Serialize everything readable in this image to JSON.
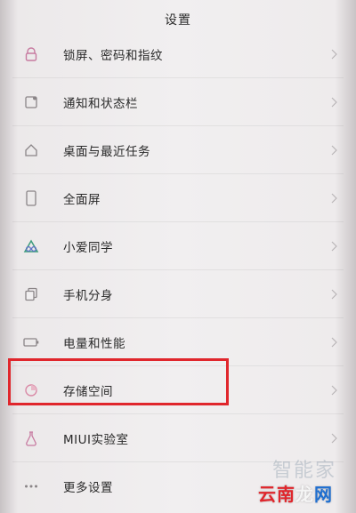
{
  "header": {
    "title": "设置"
  },
  "items": [
    {
      "label": "锁屏、密码和指纹",
      "icon": "lock-icon"
    },
    {
      "label": "通知和状态栏",
      "icon": "notification-icon"
    },
    {
      "label": "桌面与最近任务",
      "icon": "home-icon"
    },
    {
      "label": "全面屏",
      "icon": "phone-icon"
    },
    {
      "label": "小爱同学",
      "icon": "xiaoai-icon"
    },
    {
      "label": "手机分身",
      "icon": "second-space-icon"
    },
    {
      "label": "电量和性能",
      "icon": "battery-icon"
    },
    {
      "label": "存储空间",
      "icon": "storage-icon"
    },
    {
      "label": "MIUI实验室",
      "icon": "lab-icon"
    },
    {
      "label": "更多设置",
      "icon": "more-icon"
    }
  ],
  "watermark": {
    "top": "智能家",
    "bottom_red": "云南",
    "bottom_mid": "龙",
    "bottom_blue": "网"
  },
  "colors": {
    "highlight": "#e0262c",
    "icon": "#8a8587",
    "chevron": "#b9b5b7",
    "accent_icon": "#3d9c7d"
  }
}
